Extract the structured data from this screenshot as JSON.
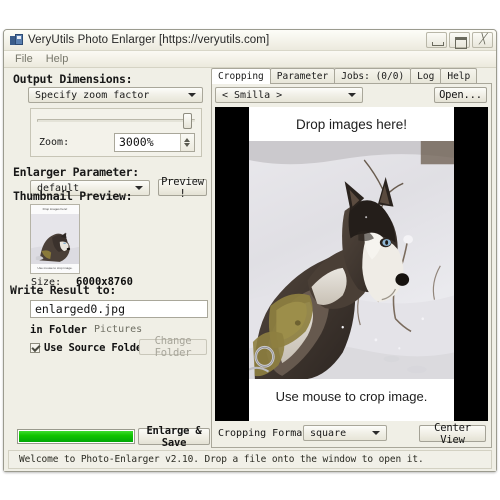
{
  "window": {
    "title": "VeryUtils Photo Enlarger [https://veryutils.com]",
    "icon": "photo-enlarger-app-icon",
    "buttons": {
      "minimize": "minimize-icon",
      "maximize": "maximize-icon",
      "close": "close-icon"
    }
  },
  "menu": {
    "items": [
      {
        "label": "File"
      },
      {
        "label": "Help"
      }
    ]
  },
  "left": {
    "output_dimensions_label": "Output Dimensions:",
    "zoom_mode": {
      "selected": "Specify zoom factor",
      "options": [
        "Specify zoom factor"
      ]
    },
    "zoom": {
      "label": "Zoom:",
      "value": "3000%",
      "slider_position_percent": 100
    },
    "enlarger_parameter_label": "Enlarger Parameter:",
    "enlarger_parameter": {
      "selected": "default",
      "options": [
        "default"
      ]
    },
    "preview_button": "Preview !",
    "thumbnail_preview_label": "Thumbnail Preview:",
    "thumbnail": {
      "top_band_text": "Drop images here!",
      "bottom_band_text": "Use mouse to crop image."
    },
    "size_label": "Size:",
    "size_value": "6000x8760",
    "write_result_label": "Write Result to:",
    "output_filename": "enlarged0.jpg",
    "in_folder_label": "in Folder",
    "folder_name": "Pictures",
    "use_source_folder": {
      "label": "Use Source Folder",
      "checked": true
    },
    "change_folder_button": "Change Folder",
    "progress_percent": 100,
    "enlarge_save_button": "Enlarge & Save"
  },
  "right": {
    "tabs": [
      {
        "label": "Cropping",
        "active": true
      },
      {
        "label": "Parameter",
        "active": false
      },
      {
        "label": "Jobs: (0/0)",
        "active": false
      },
      {
        "label": "Log",
        "active": false
      },
      {
        "label": "Help",
        "active": false
      }
    ],
    "file_combo": {
      "selected": "< Smilla >",
      "options": [
        "< Smilla >"
      ]
    },
    "open_button": "Open...",
    "canvas": {
      "drop_hint": "Drop images here!",
      "crop_hint": "Use mouse to crop image.",
      "letterbox_color": "#000000",
      "image_subject": "husky-dog-in-snow-photo"
    },
    "cropping_format_label": "Cropping Format:",
    "cropping_format": {
      "selected": "square",
      "options": [
        "square"
      ]
    },
    "center_view_button": "Center View"
  },
  "status": {
    "text": "Welcome to Photo-Enlarger v2.10.  Drop a file onto the window to open it."
  },
  "colors": {
    "window_bg": "#f0efe6",
    "progress_green": "#11c400",
    "canvas_black": "#000000",
    "text": "#1b1b1b"
  }
}
